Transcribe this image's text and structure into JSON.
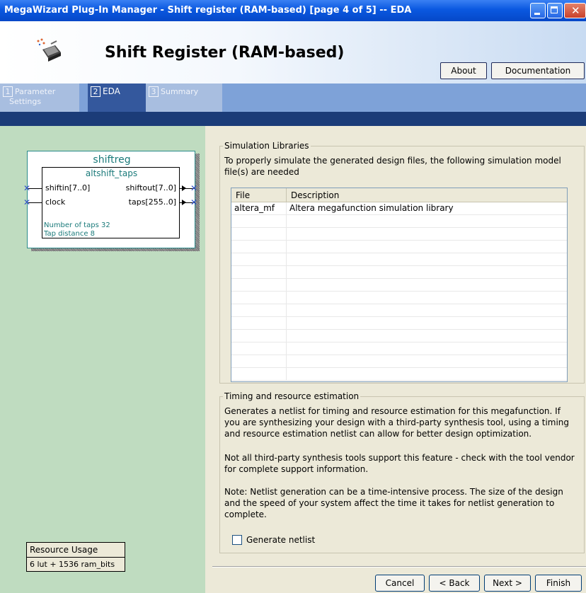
{
  "window": {
    "title": "MegaWizard Plug-In Manager - Shift register (RAM-based) [page 4 of 5] -- EDA"
  },
  "header": {
    "title": "Shift Register (RAM-based)",
    "about_label": "About",
    "documentation_label": "Documentation"
  },
  "tabs": [
    {
      "num": "1",
      "label": "Parameter",
      "label2": "Settings"
    },
    {
      "num": "2",
      "label": "EDA"
    },
    {
      "num": "3",
      "label": "Summary"
    }
  ],
  "symbol": {
    "name": "shiftreg",
    "module": "altshift_taps",
    "inputs": [
      "shiftin[7..0]",
      "clock"
    ],
    "outputs": [
      "shiftout[7..0]",
      "taps[255..0]"
    ],
    "params": [
      "Number of taps 32",
      "Tap distance 8"
    ]
  },
  "resource": {
    "title": "Resource Usage",
    "value": "6 lut + 1536 ram_bits"
  },
  "simulation": {
    "legend": "Simulation Libraries",
    "intro": "To properly simulate the generated design files, the following simulation model file(s) are needed",
    "columns": [
      "File",
      "Description"
    ],
    "rows": [
      {
        "file": "altera_mf",
        "description": "Altera megafunction simulation library"
      }
    ]
  },
  "timing": {
    "legend": "Timing and resource estimation",
    "p1": "Generates a netlist for timing and resource estimation for this megafunction. If you are synthesizing your design with a third-party synthesis tool, using a timing and resource estimation netlist can allow for better design optimization.",
    "p2": "Not all third-party synthesis tools support this feature - check with the tool vendor for complete support information.",
    "p3": "Note: Netlist generation can be a time-intensive process. The size of the design and the speed of your system affect the time it takes for netlist generation to complete.",
    "checkbox_label": "Generate netlist",
    "checkbox_checked": false
  },
  "footer": {
    "cancel": "Cancel",
    "back": "< Back",
    "next": "Next >",
    "finish": "Finish"
  }
}
